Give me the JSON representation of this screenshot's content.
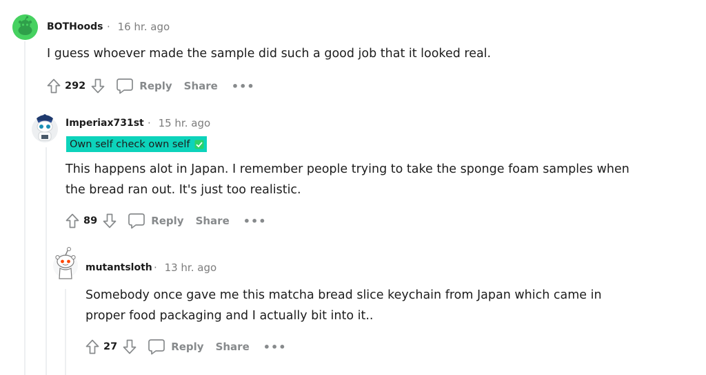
{
  "comments": [
    {
      "username": "BOTHoods",
      "time": "16 hr. ago",
      "body": [
        "I guess whoever made the sample did such a good job that it looked real."
      ],
      "score": "292",
      "avatar_color": "#46d160"
    },
    {
      "username": "Imperiax731st",
      "time": "15 hr. ago",
      "flair": "Own self check own self",
      "flair_color": "#0dd3bb",
      "body": [
        "This happens alot in Japan. I remember people trying to take the sponge foam samples when",
        "the bread ran out. It's just too realistic."
      ],
      "score": "89"
    },
    {
      "username": "mutantsloth",
      "time": "13 hr. ago",
      "body": [
        "Somebody once gave me this matcha bread slice keychain from Japan which came in",
        "proper food packaging and I actually bit into it.."
      ],
      "score": "27"
    }
  ],
  "actions": {
    "reply": "Reply",
    "share": "Share",
    "more": "•••"
  },
  "separator": "·",
  "icons": [
    "upvote-icon",
    "downvote-icon",
    "comment-icon",
    "check-icon",
    "more-icon"
  ]
}
